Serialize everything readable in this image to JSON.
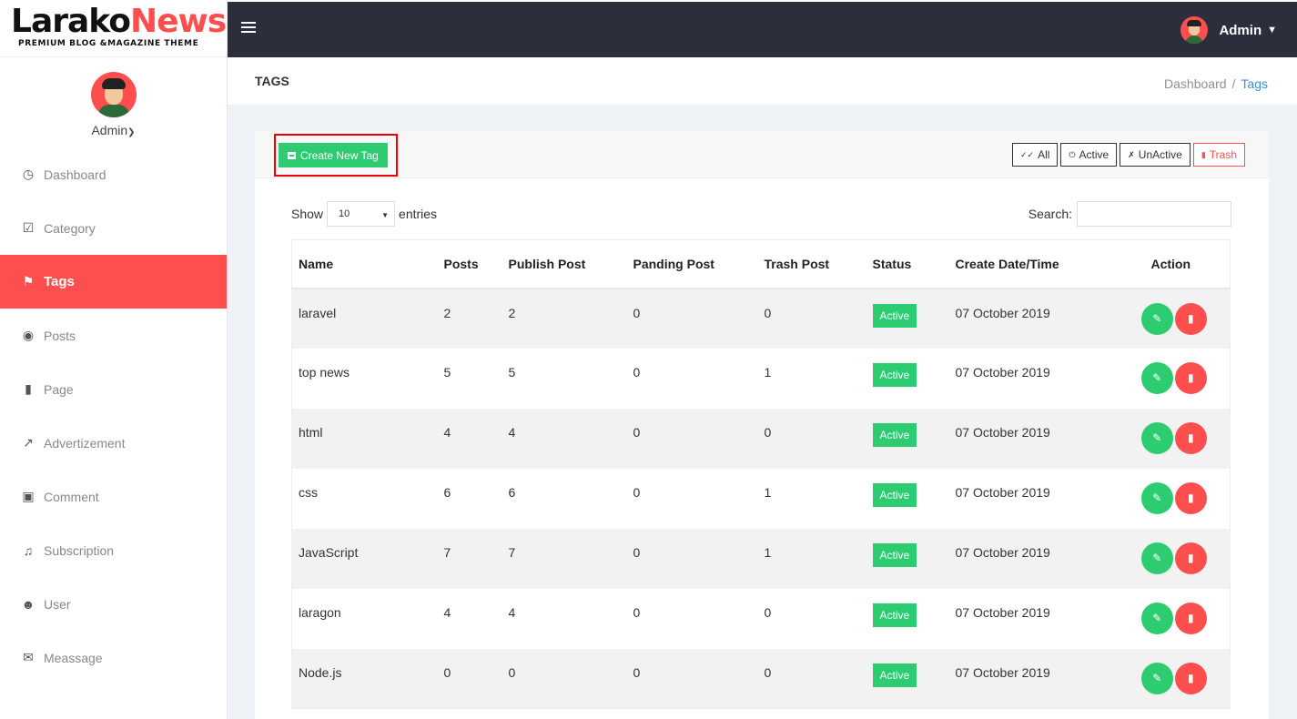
{
  "brand": {
    "part1": "Larako",
    "part2": "News",
    "tagline": "PREMIUM BLOG &MAGAZINE THEME"
  },
  "sidebar": {
    "user": "Admin",
    "items": [
      {
        "label": "Dashboard",
        "icon": "dashboard-icon",
        "active": false
      },
      {
        "label": "Category",
        "icon": "clipboard-check-icon",
        "active": false
      },
      {
        "label": "Tags",
        "icon": "tag-icon",
        "active": true
      },
      {
        "label": "Posts",
        "icon": "blog-icon",
        "active": false
      },
      {
        "label": "Page",
        "icon": "page-icon",
        "active": false
      },
      {
        "label": "Advertizement",
        "icon": "trending-up-icon",
        "active": false
      },
      {
        "label": "Comment",
        "icon": "comment-icon",
        "active": false
      },
      {
        "label": "Subscription",
        "icon": "bell-icon",
        "active": false
      },
      {
        "label": "User",
        "icon": "users-icon",
        "active": false
      },
      {
        "label": "Meassage",
        "icon": "message-icon",
        "active": false
      }
    ]
  },
  "topbar": {
    "user": "Admin"
  },
  "page": {
    "title": "TAGS",
    "breadcrumb": [
      "Dashboard",
      "Tags"
    ]
  },
  "card": {
    "create_label": "Create New Tag",
    "filters": [
      "All",
      "Active",
      "UnActive",
      "Trash"
    ],
    "show_label": "Show",
    "entries_value": "10",
    "entries_label": "entries",
    "search_label": "Search:",
    "search_value": ""
  },
  "table": {
    "headers": [
      "Name",
      "Posts",
      "Publish Post",
      "Panding Post",
      "Trash Post",
      "Status",
      "Create Date/Time",
      "Action"
    ],
    "rows": [
      [
        "laravel",
        "2",
        "2",
        "0",
        "0",
        "Active",
        "07 October 2019"
      ],
      [
        "top news",
        "5",
        "5",
        "0",
        "1",
        "Active",
        "07 October 2019"
      ],
      [
        "html",
        "4",
        "4",
        "0",
        "0",
        "Active",
        "07 October 2019"
      ],
      [
        "css",
        "6",
        "6",
        "0",
        "1",
        "Active",
        "07 October 2019"
      ],
      [
        "JavaScript",
        "7",
        "7",
        "0",
        "1",
        "Active",
        "07 October 2019"
      ],
      [
        "laragon",
        "4",
        "4",
        "0",
        "0",
        "Active",
        "07 October 2019"
      ],
      [
        "Node.js",
        "0",
        "0",
        "0",
        "0",
        "Active",
        "07 October 2019"
      ]
    ]
  },
  "colors": {
    "accent": "#ff4e4e",
    "success": "#2ecc71",
    "topbar": "#2c2f3b",
    "link": "#3c8dde"
  }
}
